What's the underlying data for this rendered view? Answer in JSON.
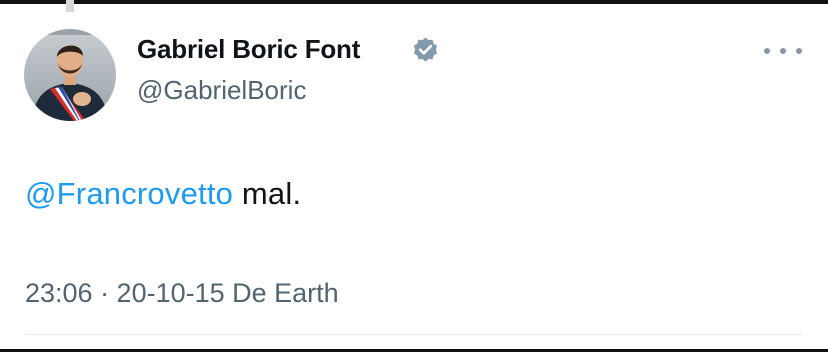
{
  "tweet": {
    "author": {
      "display_name": "Gabriel Boric Font",
      "handle": "@GabrielBoric",
      "verified": true
    },
    "mention": "@Francrovetto",
    "text_after_mention": " mal.",
    "timestamp": "23:06 · 20-10-15 De Earth",
    "icons": {
      "avatar": "profile-photo",
      "verified": "verified-badge-icon",
      "more": "more-options-icon"
    }
  },
  "colors": {
    "link": "#1d9bf0",
    "secondary_text": "#536471",
    "primary_text": "#0f1419",
    "verified_badge": "#829aab"
  }
}
